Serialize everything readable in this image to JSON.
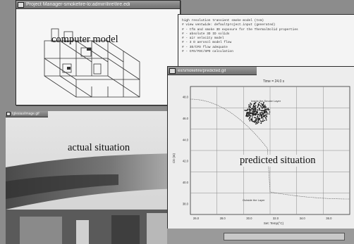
{
  "captions": {
    "model": "computer model",
    "photo": "actual situation",
    "plot": "predicted situation"
  },
  "windows": {
    "model_title": "Project Manager-smokefire-lo:admin\\fire\\fire.edi",
    "log_lines": [
      "high resolution transient smoke model (tsm)",
      "# view ventwide: defaultproject.input (generated)",
      "# - tfm and smoke 3D exposure for the ThermalSolid properties",
      "# - absolute 3D ID solids",
      "# - air velocity model",
      "# - 3 D aerosol model flow",
      "# - 3D/CFD flow adequate",
      "# - CFD/FDC/SPD calculation"
    ],
    "photo_title": "Iglesias/image.gif",
    "plot_title": "ex/smokefire/predicted.gif"
  },
  "plot": {
    "title": "Time = 24.0 s",
    "y_ticks": [
      "48.0",
      "46.0",
      "44.0",
      "42.0",
      "40.0",
      "38.0"
    ],
    "x_ticks": [
      "26.0",
      "28.0",
      "30.0",
      "32.0",
      "34.0",
      "36.0"
    ],
    "xlabel": "Set: Temp(°C)",
    "ylabel": "Ctr (m)",
    "dense_label": "Inside the Smoke Layer",
    "curve_label": "Outside the Layer"
  },
  "colors": {
    "desktop": "#8c8c8c",
    "window_bg": "#f2f2f2",
    "titlebar": "#777777"
  }
}
